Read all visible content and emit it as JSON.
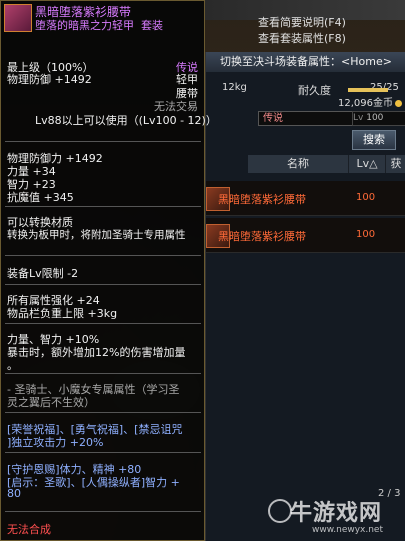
{
  "item": {
    "name": "黑暗堕落紫衫腰带",
    "set_name": "堕落的暗黑之力轻甲",
    "set_tag": "套装",
    "rarity_label": "传说",
    "type_armor": "轻甲",
    "slot": "腰带",
    "trade": "无法交易",
    "max_level": "最上级（100%）",
    "phys_def_inline": "物理防御 +1492",
    "usable_level": "Lv88以上可以使用",
    "usable_range": "(Lv100 - 12)",
    "stats": [
      "物理防御力 +1492",
      "力量 +34",
      "智力 +23",
      "抗魔值 +345"
    ],
    "convert": [
      "可以转换材质",
      "转换为板甲时，将附加圣骑士专用属性"
    ],
    "equip_lv": "装备Lv限制 -2",
    "attr_boost": "所有属性强化 +24",
    "weight": "物品栏负重上限 +3kg",
    "str_int": "力量、智力 +10%",
    "crit_bonus": [
      "暴击时，额外增加12%的伤害增加量",
      "。"
    ],
    "exclusive": [
      "- 圣骑士、小魔女专属属性（学习圣",
      "灵之翼后不生效）"
    ],
    "buff_lines": [
      "[荣誉祝福]、[勇气祝福]、[禁忌诅咒",
      "]独立攻击力 +20%"
    ],
    "grace_lines": [
      "[守护恩赐]体力、精神 +80",
      "[启示：圣歌]、[人偶操纵者]智力 +",
      "80"
    ],
    "footer": "无法合成"
  },
  "shop": {
    "hint_desc": "查看简要说明(F4)",
    "hint_set": "查看套装属性(F8)",
    "title": "切换至决斗场装备属性：<Home>",
    "weight": "12kg",
    "durability_label": "耐久度",
    "durability": "25/25",
    "gold": "12,096金币",
    "filter": "传说",
    "lv_prefix": "Lv",
    "lv_value": "100",
    "search_button": "搜索",
    "buy_button": "获得",
    "col_name": "名称",
    "col_lv": "Lv△",
    "rows": [
      {
        "name": "黑暗堕落紫衫腰带",
        "lv": "100"
      },
      {
        "name": "黑暗堕落紫衫腰带",
        "lv": "100"
      }
    ],
    "page": "2 / 3"
  },
  "watermark": {
    "text": "牛游戏网",
    "url": "www.newyx.net"
  },
  "colors": {
    "legendary_name": "#d87cff",
    "row_text": "#ff6a38",
    "blue_text": "#8fb0ff",
    "warning": "#ff5050"
  }
}
